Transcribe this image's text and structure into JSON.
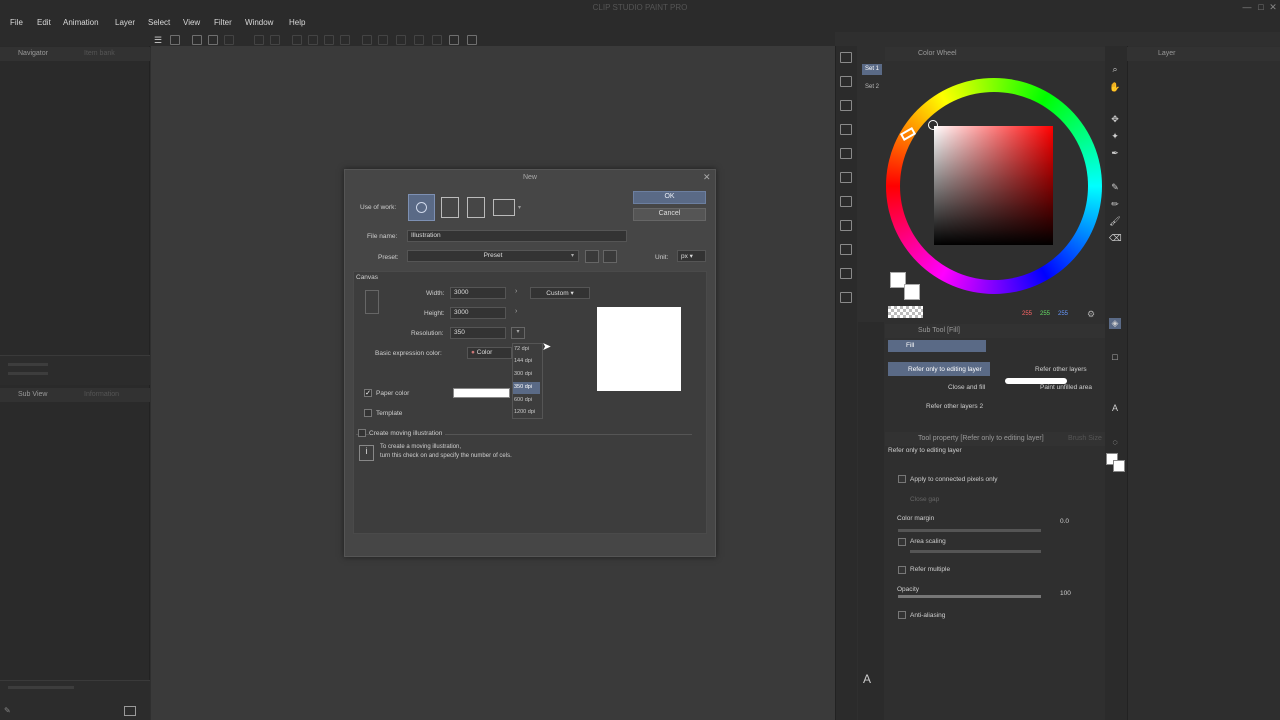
{
  "app": {
    "title": "CLIP STUDIO PAINT PRO"
  },
  "window_controls": [
    "—",
    "□",
    "✕"
  ],
  "menu": [
    "File",
    "Edit",
    "Animation",
    "Layer",
    "Select",
    "View",
    "Filter",
    "Window",
    "Help"
  ],
  "left_panel": {
    "navigator_tab": "Navigator",
    "nav_sub_tab": "Item bank",
    "subview_tab": "Sub View",
    "info_tab": "Information"
  },
  "dialog": {
    "title": "New",
    "ok": "OK",
    "cancel": "Cancel",
    "use_of_work_label": "Use of work:",
    "file_name_label": "File name:",
    "file_name_value": "Illustration",
    "preset_label": "Preset:",
    "preset_value": "Preset",
    "unit_label": "Unit:",
    "unit_value": "px",
    "canvas_section": "Canvas",
    "width_label": "Width:",
    "width_value": "3000",
    "height_label": "Height:",
    "height_value": "3000",
    "resolution_label": "Resolution:",
    "resolution_value": "350",
    "custom_value": "Custom",
    "basic_color_label": "Basic expression color:",
    "basic_color_value": "Color",
    "paper_color_label": "Paper color",
    "paper_color_checked": true,
    "template_label": "Template",
    "moving_label": "Create moving illustration",
    "info_line1": "To create a moving illustration,",
    "info_line2": "turn this check on and specify the number of cels.",
    "dpi_options": [
      "72 dpi",
      "144 dpi",
      "300 dpi",
      "350 dpi",
      "600 dpi",
      "1200 dpi"
    ],
    "dpi_selected": "350 dpi"
  },
  "color_wheel": {
    "tab": "Color Wheel",
    "set1": "Set 1",
    "set2": "Set 2",
    "r": "255",
    "g": "255",
    "b": "255",
    "main_color": "#ffffff"
  },
  "sub_tool": {
    "tab": "Sub Tool [Fill]",
    "group": "Fill",
    "items": [
      "Refer only to editing layer",
      "Refer other layers",
      "Close and fill",
      "Paint unfilled area",
      "Refer other layers 2"
    ]
  },
  "tool_property": {
    "tab": "Tool property [Refer only to editing layer]",
    "tab2": "Brush Size",
    "title": "Refer only to editing layer",
    "apply_connected": "Apply to connected pixels only",
    "close_gap": "Close gap",
    "color_margin": "Color margin",
    "color_margin_value": "0.0",
    "area_scaling": "Area scaling",
    "refer_multiple": "Refer multiple",
    "opacity": "Opacity",
    "opacity_value": "100",
    "anti_aliasing": "Anti-aliasing"
  },
  "layer_panel": {
    "tab": "Layer"
  }
}
